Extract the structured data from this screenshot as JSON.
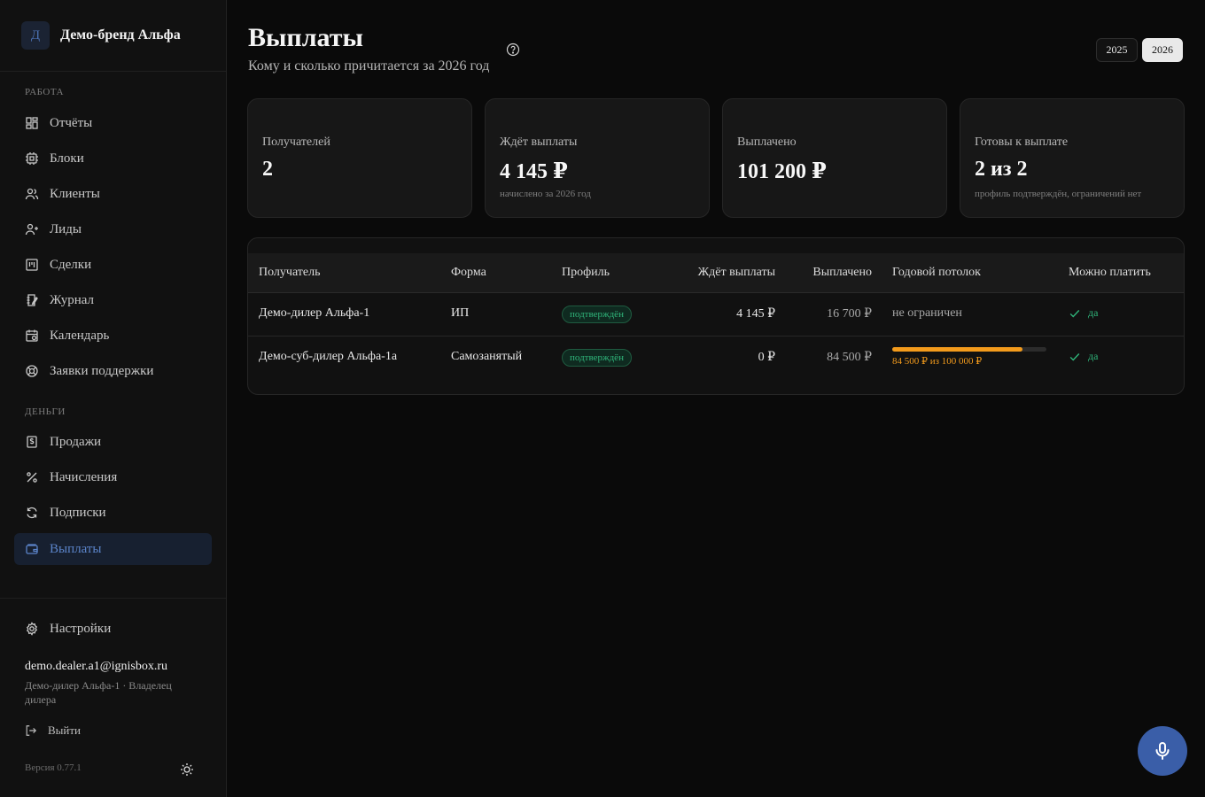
{
  "brand": {
    "logo_letter": "Д",
    "name": "Демо-бренд Альфа"
  },
  "sidebar": {
    "section_work": "Работа",
    "section_money": "Деньги",
    "items": [
      {
        "label": "Отчёты",
        "icon": "dashboard-icon"
      },
      {
        "label": "Блоки",
        "icon": "chip-icon"
      },
      {
        "label": "Клиенты",
        "icon": "users-icon"
      },
      {
        "label": "Лиды",
        "icon": "user-plus-icon"
      },
      {
        "label": "Сделки",
        "icon": "kanban-icon"
      },
      {
        "label": "Журнал",
        "icon": "journal-icon"
      },
      {
        "label": "Календарь",
        "icon": "calendar-icon"
      },
      {
        "label": "Заявки поддержки",
        "icon": "lifebuoy-icon"
      },
      {
        "label": "Продажи",
        "icon": "receipt-icon"
      },
      {
        "label": "Начисления",
        "icon": "percent-icon"
      },
      {
        "label": "Подписки",
        "icon": "refresh-icon"
      },
      {
        "label": "Выплаты",
        "icon": "wallet-icon",
        "active": true
      }
    ],
    "settings_label": "Настройки",
    "user_email": "demo.dealer.a1@ignisbox.ru",
    "user_role": "Демо-дилер Альфа-1 · Владелец дилера",
    "logout_label": "Выйти",
    "version": "Версия 0.77.1"
  },
  "header": {
    "title": "Выплаты",
    "subtitle": "Кому и сколько причитается за 2026 год",
    "years": [
      "2025",
      "2026"
    ],
    "selected_year": "2026"
  },
  "stats": [
    {
      "label": "Получателей",
      "value": "2",
      "sub": ""
    },
    {
      "label": "Ждёт выплаты",
      "value": "4 145 ₽",
      "sub": "начислено за 2026 год"
    },
    {
      "label": "Выплачено",
      "value": "101 200 ₽",
      "sub": ""
    },
    {
      "label": "Готовы к выплате",
      "value": "2 из 2",
      "sub": "профиль подтверждён, ограничений нет"
    }
  ],
  "table": {
    "columns": [
      "Получатель",
      "Форма",
      "Профиль",
      "Ждёт выплаты",
      "Выплачено",
      "Годовой потолок",
      "Можно платить"
    ],
    "rows": [
      {
        "recipient": "Демо-дилер Альфа-1",
        "form": "ИП",
        "profile": "подтверждён",
        "pending": "4 145 ₽",
        "paid": "16 700 ₽",
        "cap_text": "не ограничен",
        "can_pay": "да"
      },
      {
        "recipient": "Демо-суб-дилер Альфа-1а",
        "form": "Самозанятый",
        "profile": "подтверждён",
        "pending": "0 ₽",
        "paid": "84 500 ₽",
        "cap_text": "84 500 ₽ из 100 000 ₽",
        "cap_fraction": 0.845,
        "can_pay": "да"
      }
    ]
  },
  "colors": {
    "accent": "#3a5ea8",
    "success": "#2fb57a",
    "warning": "#f39b1c"
  }
}
